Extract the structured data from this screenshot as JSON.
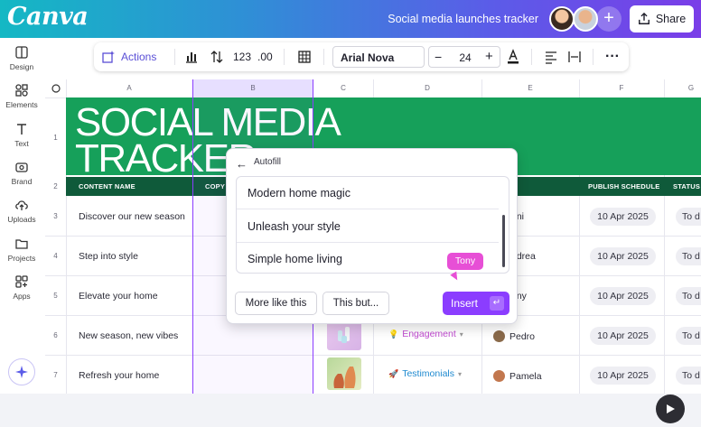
{
  "app": {
    "logo": "Canva",
    "doc_title": "Social media launches tracker",
    "share_label": "Share"
  },
  "sidebar": {
    "items": [
      {
        "label": "Design",
        "icon": "design-icon"
      },
      {
        "label": "Elements",
        "icon": "elements-icon"
      },
      {
        "label": "Text",
        "icon": "text-icon"
      },
      {
        "label": "Brand",
        "icon": "brand-icon"
      },
      {
        "label": "Uploads",
        "icon": "uploads-icon"
      },
      {
        "label": "Projects",
        "icon": "projects-icon"
      },
      {
        "label": "Apps",
        "icon": "apps-icon"
      }
    ]
  },
  "toolbar": {
    "actions": "Actions",
    "number_format": "123",
    "decimal": ".00",
    "font": "Arial Nova",
    "font_size": "24"
  },
  "sheet": {
    "columns": [
      "A",
      "B",
      "C",
      "D",
      "E",
      "F",
      "G"
    ],
    "row_numbers": [
      "1",
      "2",
      "3",
      "4",
      "5",
      "6",
      "7"
    ],
    "banner_title": "SOCIAL MEDIA\nTRACKER",
    "headers": {
      "content_name": "CONTENT NAME",
      "copy": "COPY",
      "publish": "PUBLISH SCHEDULE",
      "status": "STATUS"
    },
    "rows": [
      {
        "name": "Discover our new season",
        "person": "oni",
        "date": "10 Apr 2025",
        "status": "To d"
      },
      {
        "name": "Step into style",
        "person": "ndrea",
        "date": "10 Apr 2025",
        "status": "To d"
      },
      {
        "name": "Elevate your home",
        "person": "ony",
        "date": "10 Apr 2025",
        "status": "To d"
      },
      {
        "name": "New season, new vibes",
        "tag": "Engagement",
        "person": "Pedro",
        "date": "10 Apr 2025",
        "status": "To d"
      },
      {
        "name": "Refresh your home",
        "tag": "Testimonials",
        "person": "Pamela",
        "date": "10 Apr 2025",
        "status": "To d"
      }
    ]
  },
  "autofill": {
    "title": "Autofill",
    "options": [
      "Modern home magic",
      "Unleash your style",
      "Simple home living"
    ],
    "more_label": "More like this",
    "this_but_label": "This but...",
    "insert_label": "Insert",
    "collaborator": "Tony"
  },
  "colors": {
    "accent": "#8b3dff",
    "banner": "#16a05a",
    "header_row": "#0f5a3a",
    "collaborator": "#e74fd6"
  }
}
